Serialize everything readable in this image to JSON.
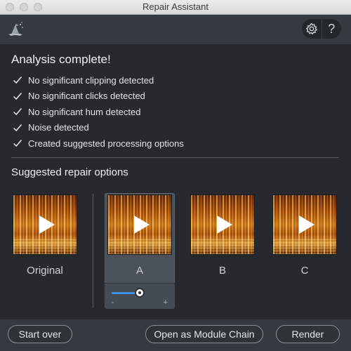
{
  "window": {
    "title": "Repair Assistant"
  },
  "header": {
    "logo_icon": "wizard-hat-icon",
    "settings_icon": "gear-icon",
    "help_label": "?"
  },
  "analysis": {
    "title": "Analysis complete!",
    "items": [
      "No significant clipping detected",
      "No significant clicks detected",
      "No significant hum detected",
      "Noise detected",
      "Created suggested processing options"
    ]
  },
  "suggestions": {
    "title": "Suggested repair options",
    "options": [
      {
        "label": "Original"
      },
      {
        "label": "A",
        "selected": true
      },
      {
        "label": "B"
      },
      {
        "label": "C"
      }
    ],
    "strength_slider": {
      "min_label": "-",
      "max_label": "+",
      "value_fraction": 0.5,
      "accent": "#3d8fe0"
    }
  },
  "footer": {
    "start_over": "Start over",
    "open_chain": "Open as Module Chain",
    "render": "Render"
  }
}
